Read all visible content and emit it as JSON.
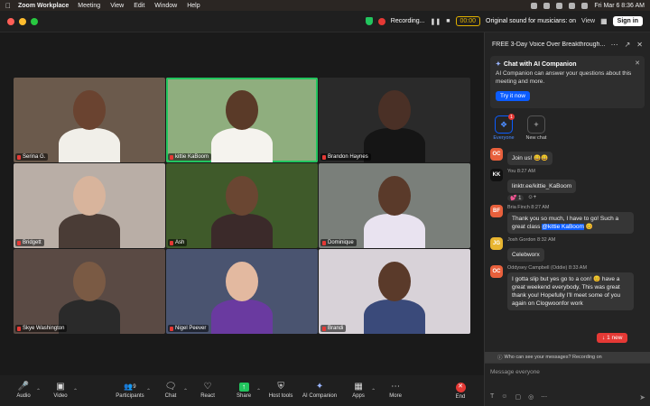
{
  "menubar": {
    "app_name": "Zoom Workplace",
    "items": [
      "Meeting",
      "View",
      "Edit",
      "Window",
      "Help"
    ],
    "clock": "Fri Mar 6  8:36 AM"
  },
  "titlebar": {
    "recording_label": "Recording...",
    "timer": "00:00",
    "sound_label": "Original sound for musicians: on",
    "view_label": "View",
    "signin_label": "Sign in"
  },
  "participants": [
    {
      "name": "Serina G.",
      "bg": "#6b5a4c",
      "skin": "#6a4330",
      "shirt": "#f1efe9"
    },
    {
      "name": "kittie KaBoom",
      "bg": "#8fae7e",
      "skin": "#5a3a28",
      "shirt": "#f5f3ee"
    },
    {
      "name": "Brandon Haynes",
      "bg": "#2a2a2a",
      "skin": "#4a3026",
      "shirt": "#151515"
    },
    {
      "name": "Bridgett",
      "bg": "#b9aea6",
      "skin": "#d8b49c",
      "shirt": "#4a3c36"
    },
    {
      "name": "Ash",
      "bg": "#3f5a2a",
      "skin": "#6a4632",
      "shirt": "#3b2a2a"
    },
    {
      "name": "Dominique",
      "bg": "#7a7f7a",
      "skin": "#5a3a2a",
      "shirt": "#e9e3f0"
    },
    {
      "name": "Skye Washington",
      "bg": "#5a4a44",
      "skin": "#7a5a44",
      "shirt": "#2a2a2a"
    },
    {
      "name": "Nigel Peever",
      "bg": "#4a5470",
      "skin": "#e3b9a0",
      "shirt": "#6a3aa0"
    },
    {
      "name": "Brandi",
      "bg": "#d8d2d8",
      "skin": "#5a3a2a",
      "shirt": "#3a4a7a"
    }
  ],
  "toolbar": {
    "audio": "Audio",
    "video": "Video",
    "participants": "Participants",
    "participants_count": "9",
    "chat": "Chat",
    "react": "React",
    "share": "Share",
    "host_tools": "Host tools",
    "ai_companion": "AI Companion",
    "apps": "Apps",
    "more": "More",
    "end": "End"
  },
  "panel": {
    "title": "FREE 3-Day Voice Over Breakthrough...",
    "ai_card": {
      "title": "Chat with AI Companion",
      "description": "AI Companion can answer your questions about this meeting and more.",
      "button": "Try it now"
    },
    "tabs": [
      {
        "label": "Everyone",
        "badge": "1"
      },
      {
        "label": "New chat",
        "badge": ""
      }
    ],
    "messages": [
      {
        "initials": "OC",
        "avatar_color": "#e8603c",
        "sender": "",
        "time": "",
        "text": "Join us! 😀😀",
        "mention": "",
        "after": ""
      },
      {
        "initials": "KK",
        "avatar_color": "#111111",
        "sender": "You",
        "time": "8:27 AM",
        "text": "linktr.ee/kittie_KaBoom",
        "mention": "",
        "after": "",
        "reaction": "💕 1"
      },
      {
        "initials": "BF",
        "avatar_color": "#e8603c",
        "sender": "Bria Finch",
        "time": "8:27 AM",
        "text": "Thank you so much, I have to go! Such a great class ",
        "mention": "@kittie KaBoom",
        "after": " 😊"
      },
      {
        "initials": "JG",
        "avatar_color": "#e8b530",
        "sender": "Josh Gordon",
        "time": "8:32 AM",
        "text": "Celebworx",
        "mention": "",
        "after": ""
      },
      {
        "initials": "OC",
        "avatar_color": "#e8603c",
        "sender": "Oddysey Campbell (Oddie)",
        "time": "8:33 AM",
        "text": "I gotta slip but yes go to a con! 😊 have a great weekend everybody. This was great thank you! Hopefully I'll meet some of you again on Clogwoonfor work",
        "mention": "",
        "after": ""
      }
    ],
    "new_label": "1 new",
    "who_see": "Who can see your messages? Recording on",
    "compose_placeholder": "Message everyone"
  }
}
